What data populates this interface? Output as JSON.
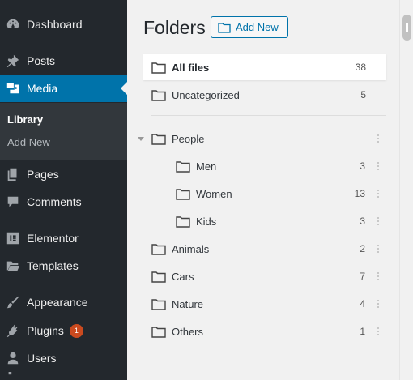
{
  "sidebar": {
    "items": [
      {
        "label": "Dashboard",
        "icon": "dashboard-icon"
      },
      {
        "label": "Posts",
        "icon": "pin-icon"
      },
      {
        "label": "Media",
        "icon": "media-icon"
      },
      {
        "label": "Pages",
        "icon": "pages-icon"
      },
      {
        "label": "Comments",
        "icon": "comments-icon"
      },
      {
        "label": "Elementor",
        "icon": "elementor-icon"
      },
      {
        "label": "Templates",
        "icon": "folder-open-icon"
      },
      {
        "label": "Appearance",
        "icon": "brush-icon"
      },
      {
        "label": "Plugins",
        "icon": "plug-icon",
        "badge": "1"
      },
      {
        "label": "Users",
        "icon": "user-icon"
      }
    ],
    "submenu": {
      "library": "Library",
      "add_new": "Add New"
    }
  },
  "main": {
    "title": "Folders",
    "add_new_button": "Add New",
    "all_files": {
      "label": "All files",
      "count": "38"
    },
    "uncategorized": {
      "label": "Uncategorized",
      "count": "5"
    },
    "folders": [
      {
        "label": "People",
        "count": ""
      },
      {
        "label": "Men",
        "count": "3"
      },
      {
        "label": "Women",
        "count": "13"
      },
      {
        "label": "Kids",
        "count": "3"
      },
      {
        "label": "Animals",
        "count": "2"
      },
      {
        "label": "Cars",
        "count": "7"
      },
      {
        "label": "Nature",
        "count": "4"
      },
      {
        "label": "Others",
        "count": "1"
      }
    ]
  },
  "colors": {
    "sidebar_bg": "#23282d",
    "active_bg": "#0073aa",
    "badge": "#ca4a1f",
    "accent": "#0073aa"
  }
}
